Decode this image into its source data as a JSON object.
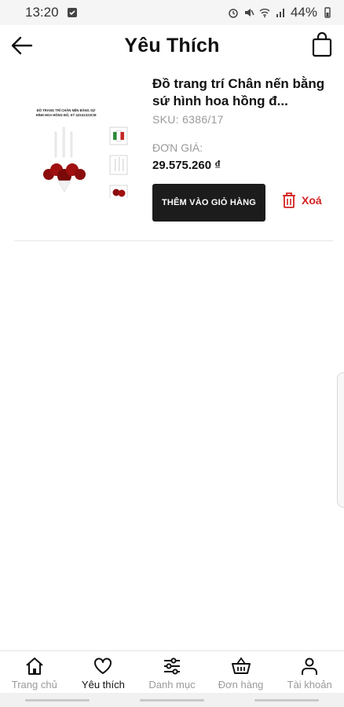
{
  "status_bar": {
    "time": "13:20",
    "battery": "44%"
  },
  "header": {
    "title": "Yêu Thích"
  },
  "wishlist": [
    {
      "name": "Đồ trang trí Chân nến bằng sứ hình hoa hồng  đ...",
      "sku": "SKU: 6386/17",
      "price_label": "ĐƠN GIÁ:",
      "price": "29.575.260 ₫",
      "add_to_cart_label": "THÊM VÀO GIỎ HÀNG",
      "remove_label": "Xoá",
      "thumbnail_caption": "ĐỒ TRANG TRÍ CHÂN NẾN BẰNG SỨ HÌNH HOA HỒNG ĐỎ, KT 42X41X22CM"
    }
  ],
  "bottom_nav": [
    {
      "label": "Trang chủ",
      "icon": "home-icon"
    },
    {
      "label": "Yêu thích",
      "icon": "heart-icon"
    },
    {
      "label": "Danh mục",
      "icon": "sliders-icon"
    },
    {
      "label": "Đơn hàng",
      "icon": "basket-icon"
    },
    {
      "label": "Tài khoản",
      "icon": "user-icon"
    }
  ],
  "colors": {
    "accent": "#1c1c1c",
    "danger": "#d32020",
    "muted": "#9a9a9a"
  }
}
